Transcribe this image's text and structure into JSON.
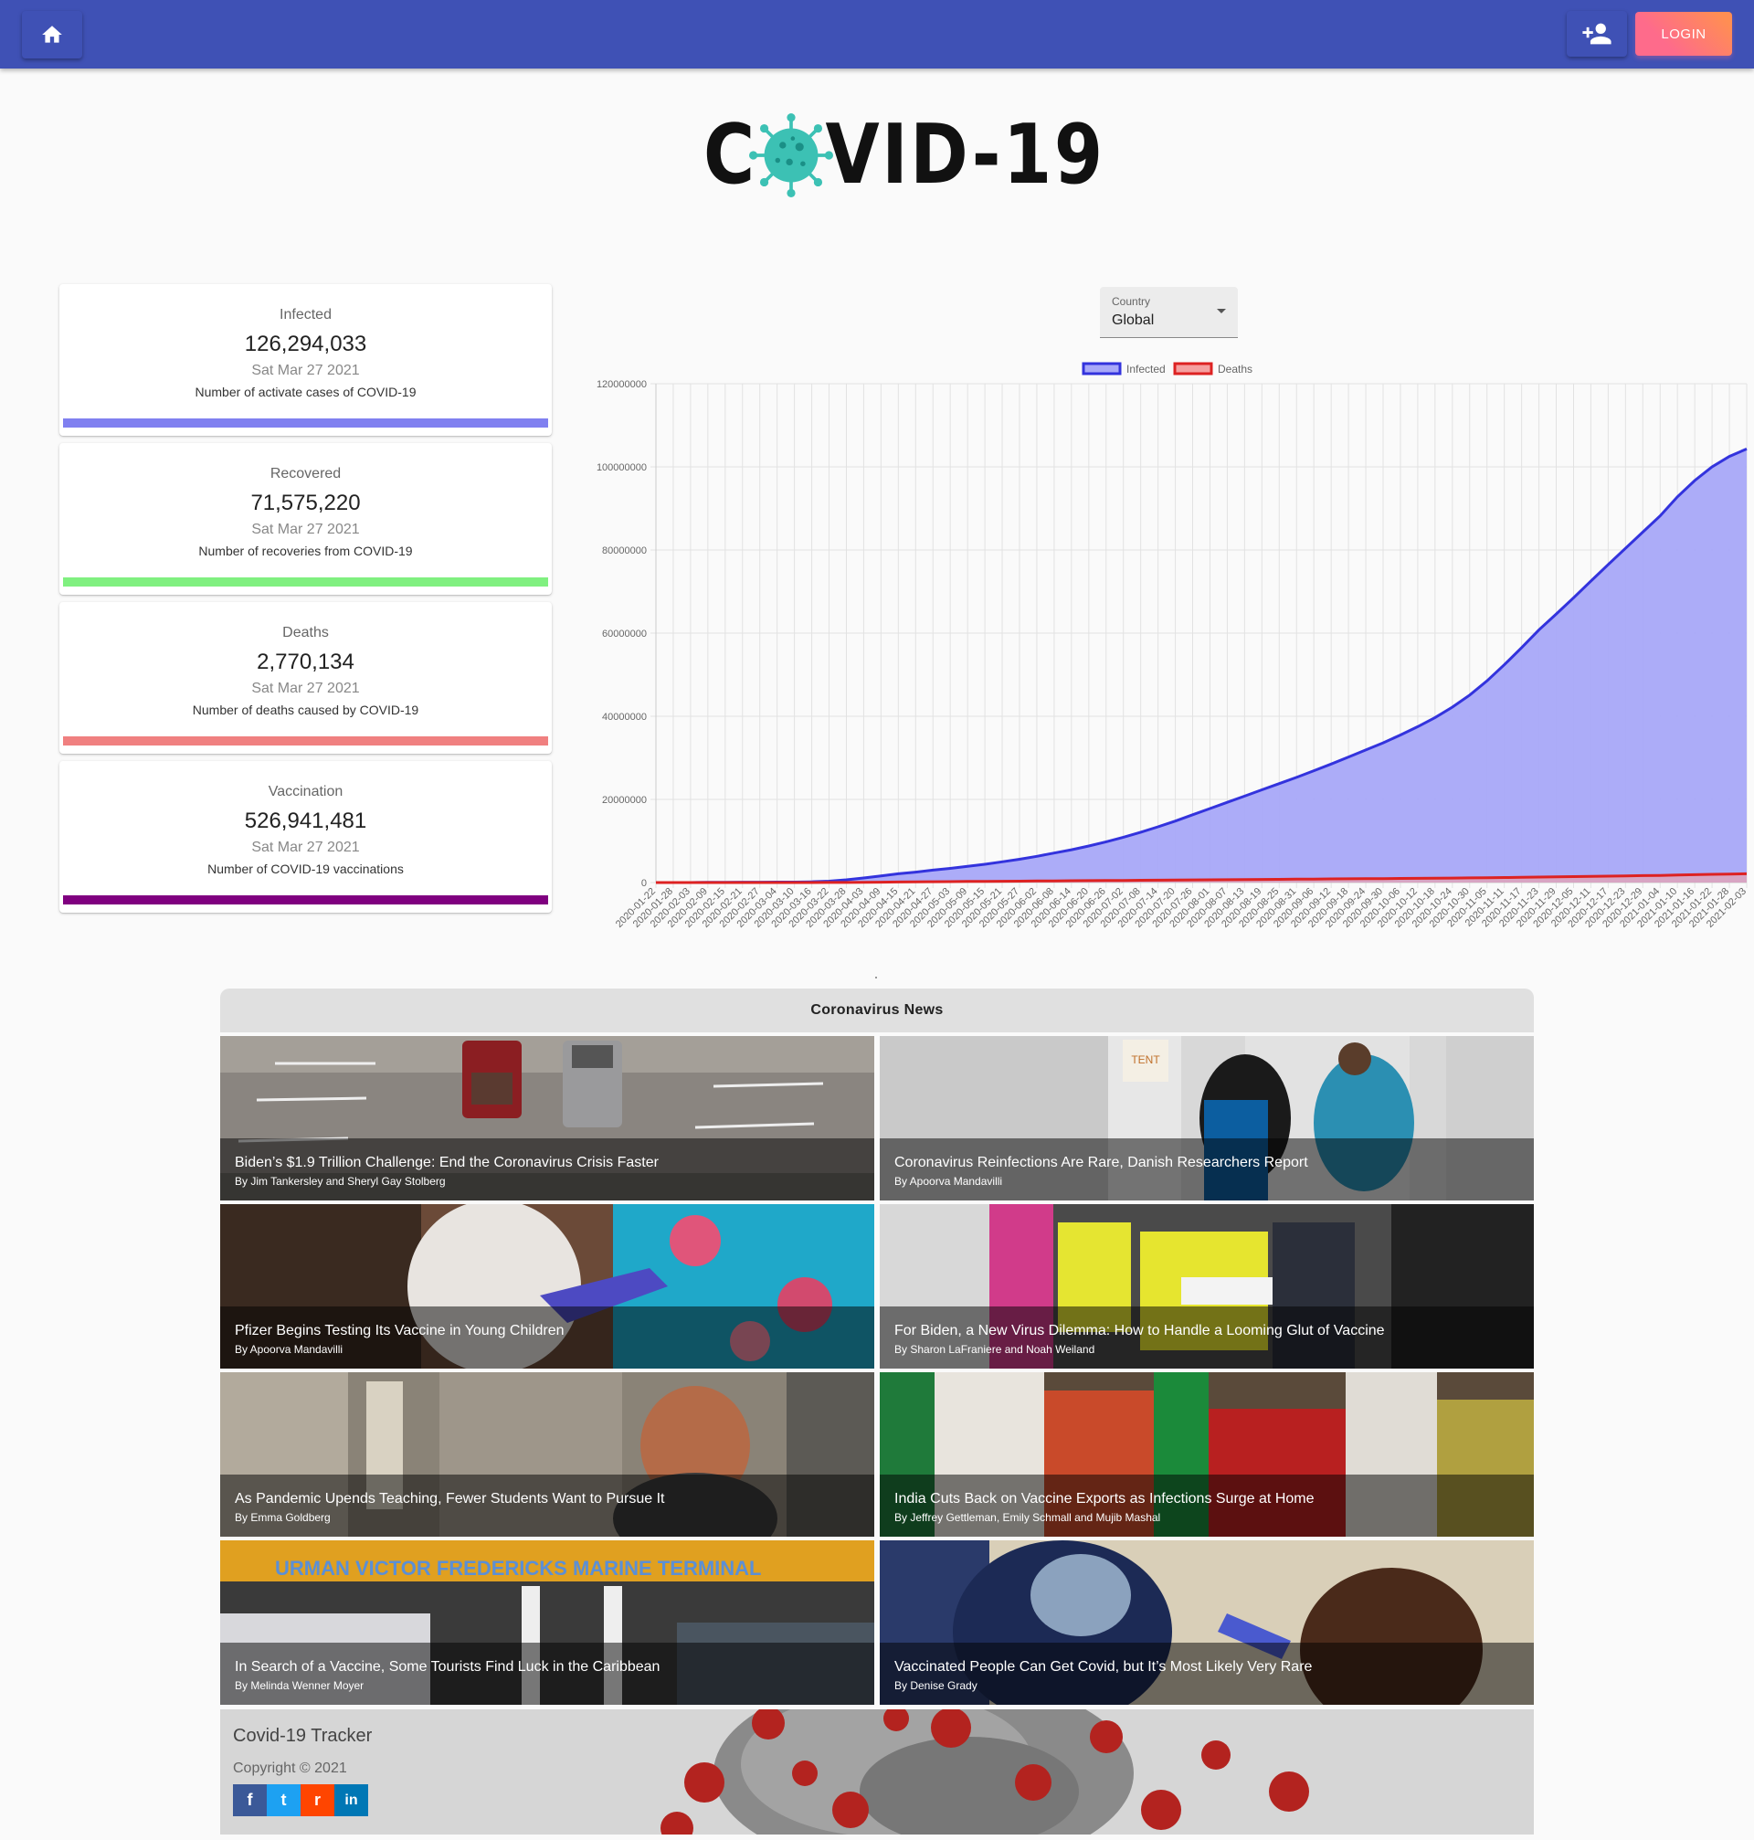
{
  "nav": {
    "home_icon": "home-icon",
    "add_user_icon": "person-add-icon",
    "login_label": "LOGIN"
  },
  "logo": {
    "text_left": "C",
    "text_right": "VID-19",
    "virus_icon": "virus-icon"
  },
  "stats": [
    {
      "title": "Infected",
      "value": "126,294,033",
      "date": "Sat Mar 27 2021",
      "desc": "Number of activate cases of COVID-19",
      "color": "#8080f0"
    },
    {
      "title": "Recovered",
      "value": "71,575,220",
      "date": "Sat Mar 27 2021",
      "desc": "Number of recoveries from COVID-19",
      "color": "#80f080"
    },
    {
      "title": "Deaths",
      "value": "2,770,134",
      "date": "Sat Mar 27 2021",
      "desc": "Number of deaths caused by COVID-19",
      "color": "#f08080"
    },
    {
      "title": "Vaccination",
      "value": "526,941,481",
      "date": "Sat Mar 27 2021",
      "desc": "Number of COVID-19 vaccinations",
      "color": "#800080"
    }
  ],
  "country_select": {
    "label": "Country",
    "value": "Global"
  },
  "chart_data": {
    "type": "area",
    "legend": [
      "Infected",
      "Deaths"
    ],
    "legend_position": "top",
    "grid": true,
    "ylim": [
      0,
      120000000
    ],
    "yticks": [
      "0",
      "20000000",
      "40000000",
      "60000000",
      "80000000",
      "100000000",
      "120000000"
    ],
    "x": [
      "2020-01-22",
      "2020-01-28",
      "2020-02-03",
      "2020-02-09",
      "2020-02-15",
      "2020-02-21",
      "2020-02-27",
      "2020-03-04",
      "2020-03-10",
      "2020-03-16",
      "2020-03-22",
      "2020-03-28",
      "2020-04-03",
      "2020-04-09",
      "2020-04-15",
      "2020-04-21",
      "2020-04-27",
      "2020-05-03",
      "2020-05-09",
      "2020-05-15",
      "2020-05-21",
      "2020-05-27",
      "2020-06-02",
      "2020-06-08",
      "2020-06-14",
      "2020-06-20",
      "2020-06-26",
      "2020-07-02",
      "2020-07-08",
      "2020-07-14",
      "2020-07-20",
      "2020-07-26",
      "2020-08-01",
      "2020-08-07",
      "2020-08-13",
      "2020-08-19",
      "2020-08-25",
      "2020-08-31",
      "2020-09-06",
      "2020-09-12",
      "2020-09-18",
      "2020-09-24",
      "2020-09-30",
      "2020-10-06",
      "2020-10-12",
      "2020-10-18",
      "2020-10-24",
      "2020-10-30",
      "2020-11-05",
      "2020-11-11",
      "2020-11-17",
      "2020-11-23",
      "2020-11-29",
      "2020-12-05",
      "2020-12-11",
      "2020-12-17",
      "2020-12-23",
      "2020-12-29",
      "2021-01-04",
      "2021-01-10",
      "2021-01-16",
      "2021-01-22",
      "2021-01-28",
      "2021-02-03"
    ],
    "series": [
      {
        "name": "Infected",
        "color": "#3333dd",
        "fill": "#a8a8f8",
        "values": [
          0,
          0,
          10000,
          40000,
          70000,
          80000,
          90000,
          100000,
          120000,
          180000,
          340000,
          660000,
          1100000,
          1600000,
          2100000,
          2500000,
          3000000,
          3400000,
          3900000,
          4400000,
          5000000,
          5600000,
          6300000,
          7100000,
          7900000,
          8800000,
          9800000,
          10900000,
          12100000,
          13400000,
          14800000,
          16300000,
          17800000,
          19300000,
          20800000,
          22300000,
          23800000,
          25300000,
          26900000,
          28500000,
          30200000,
          31900000,
          33600000,
          35500000,
          37500000,
          39700000,
          42200000,
          45100000,
          48500000,
          52400000,
          56500000,
          60800000,
          64600000,
          68500000,
          72500000,
          76500000,
          80400000,
          84300000,
          88200000,
          92800000,
          96700000,
          100000000,
          102500000,
          104300000
        ]
      },
      {
        "name": "Deaths",
        "color": "#dd2222",
        "fill": "#f5a0a0",
        "values": [
          0,
          0,
          0,
          1000,
          2000,
          2000,
          3000,
          4000,
          5000,
          7000,
          15000,
          30000,
          55000,
          90000,
          130000,
          170000,
          200000,
          230000,
          260000,
          280000,
          310000,
          340000,
          370000,
          400000,
          430000,
          460000,
          490000,
          510000,
          540000,
          570000,
          600000,
          630000,
          660000,
          690000,
          720000,
          750000,
          780000,
          810000,
          840000,
          870000,
          900000,
          920000,
          950000,
          980000,
          1010000,
          1050000,
          1080000,
          1120000,
          1160000,
          1210000,
          1260000,
          1320000,
          1370000,
          1420000,
          1480000,
          1540000,
          1600000,
          1660000,
          1720000,
          1800000,
          1880000,
          1970000,
          2050000,
          2120000
        ]
      }
    ]
  },
  "news": {
    "title": "Coronavirus News",
    "items": [
      {
        "headline": "Biden’s $1.9 Trillion Challenge: End the Coronavirus Crisis Faster",
        "author": "By Jim Tankersley and Sheryl Gay Stolberg"
      },
      {
        "headline": "Coronavirus Reinfections Are Rare, Danish Researchers Report",
        "author": "By Apoorva Mandavilli"
      },
      {
        "headline": "Pfizer Begins Testing Its Vaccine in Young Children",
        "author": "By Apoorva Mandavilli"
      },
      {
        "headline": "For Biden, a New Virus Dilemma: How to Handle a Looming Glut of Vaccine",
        "author": "By Sharon LaFraniere and Noah Weiland"
      },
      {
        "headline": "As Pandemic Upends Teaching, Fewer Students Want to Pursue It",
        "author": "By Emma Goldberg"
      },
      {
        "headline": "India Cuts Back on Vaccine Exports as Infections Surge at Home",
        "author": "By Jeffrey Gettleman, Emily Schmall and Mujib Mashal"
      },
      {
        "headline": "In Search of a Vaccine, Some Tourists Find Luck in the Caribbean",
        "author": "By Melinda Wenner Moyer"
      },
      {
        "headline": "Vaccinated People Can Get Covid, but It’s Most Likely Very Rare",
        "author": "By Denise Grady"
      }
    ],
    "tent_sign": "TENT",
    "terminal_sign": "URMAN VICTOR FREDERICKS MARINE TERMINAL"
  },
  "footer": {
    "title": "Covid-19 Tracker",
    "copyright": "Copyright © 2021",
    "social": [
      {
        "icon": "facebook-icon",
        "glyph": "f",
        "color": "#3b5998"
      },
      {
        "icon": "twitter-icon",
        "glyph": "t",
        "color": "#1da1f2"
      },
      {
        "icon": "reddit-icon",
        "glyph": "r",
        "color": "#ff4500"
      },
      {
        "icon": "linkedin-icon",
        "glyph": "in",
        "color": "#0077b5"
      }
    ]
  }
}
